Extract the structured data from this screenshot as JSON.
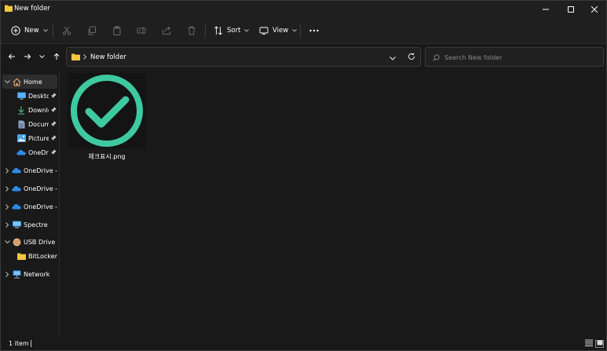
{
  "window": {
    "title": "New folder",
    "controls": {
      "minimize": "minimize-icon",
      "maximize": "maximize-icon",
      "close": "close-icon"
    }
  },
  "toolbar": {
    "new_label": "New",
    "sort_label": "Sort",
    "view_label": "View",
    "icons": [
      "cut-icon",
      "copy-icon",
      "paste-icon",
      "rename-icon",
      "share-icon",
      "delete-icon",
      "more-icon"
    ]
  },
  "address": {
    "path": [
      "New folder"
    ]
  },
  "search": {
    "placeholder": "Search New folder"
  },
  "sidebar": {
    "items": [
      {
        "label": "Home",
        "icon": "home-icon",
        "selected": true
      },
      {
        "label": "Desktop",
        "icon": "desktop-icon",
        "pinned": true
      },
      {
        "label": "Downloads",
        "icon": "download-icon",
        "pinned": true
      },
      {
        "label": "Documents",
        "icon": "documents-icon",
        "pinned": true
      },
      {
        "label": "Pictures",
        "icon": "pictures-icon",
        "pinned": true
      },
      {
        "label": "OneDrive",
        "icon": "onedrive-icon",
        "pinned": true
      },
      {
        "label": "OneDrive -",
        "icon": "onedrive-icon"
      },
      {
        "label": "OneDrive -",
        "icon": "onedrive-icon"
      },
      {
        "label": "OneDrive -",
        "icon": "onedrive-icon"
      },
      {
        "label": "Spectre",
        "icon": "pc-icon"
      },
      {
        "label": "USB Drive (I",
        "icon": "usb-drive-icon"
      },
      {
        "label": "BitLocker",
        "icon": "folder-icon"
      },
      {
        "label": "Network",
        "icon": "network-icon"
      }
    ]
  },
  "files": [
    {
      "name": "체크표시.png",
      "thumbnail": "green-check-circle",
      "color": "#3ec9a0"
    }
  ],
  "status": {
    "item_count": "1 item"
  },
  "colors": {
    "background": "#191919",
    "accent_check": "#3ec9a0",
    "folder_yellow": "#f4c542"
  }
}
